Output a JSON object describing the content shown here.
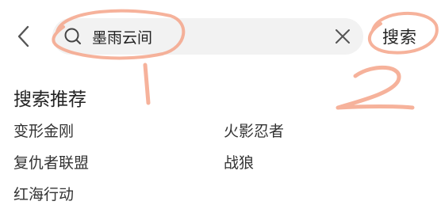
{
  "search": {
    "query": "墨雨云间",
    "submit_label": "搜索"
  },
  "recommendations": {
    "title": "搜索推荐",
    "items": [
      "变形金刚",
      "火影忍者",
      "复仇者联盟",
      "战狼",
      "红海行动"
    ]
  },
  "annotations": {
    "labels": [
      "1",
      "2"
    ],
    "color": "#f5a58a"
  },
  "colors": {
    "search_bg": "#f2f2f2",
    "text": "#1f1f1f"
  },
  "icons": {
    "back": "back-arrow-icon",
    "search": "search-icon",
    "clear": "close-icon"
  }
}
